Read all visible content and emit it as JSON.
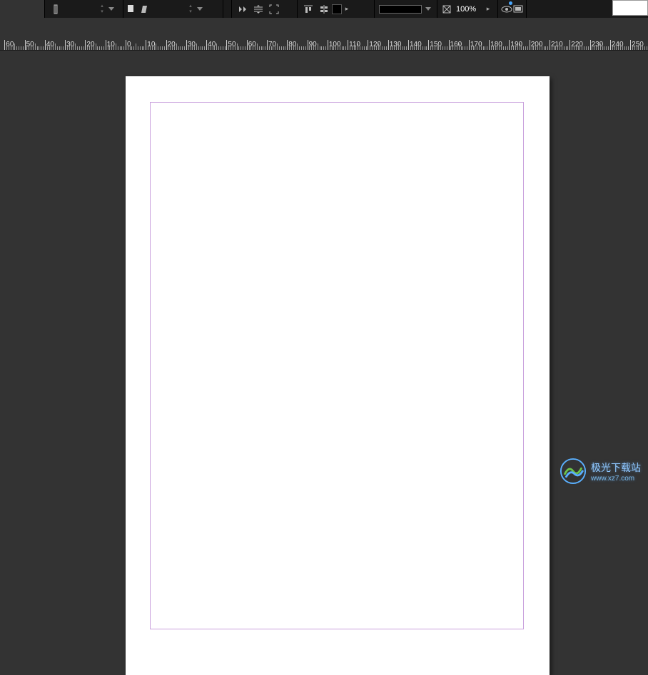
{
  "toolbar": {
    "font_size_value": "",
    "leading_value": "",
    "zoom_value": "100%",
    "stroke_weight": ""
  },
  "ruler": {
    "ticks": [
      -60,
      -50,
      -40,
      -30,
      -20,
      -10,
      0,
      10,
      20,
      30,
      40,
      50,
      60,
      70,
      80,
      90,
      100,
      110,
      120,
      130,
      140,
      150,
      160,
      170,
      180,
      190,
      200,
      210,
      220,
      230,
      240,
      250
    ]
  },
  "watermark": {
    "title": "极光下载站",
    "url": "www.xz7.com"
  }
}
